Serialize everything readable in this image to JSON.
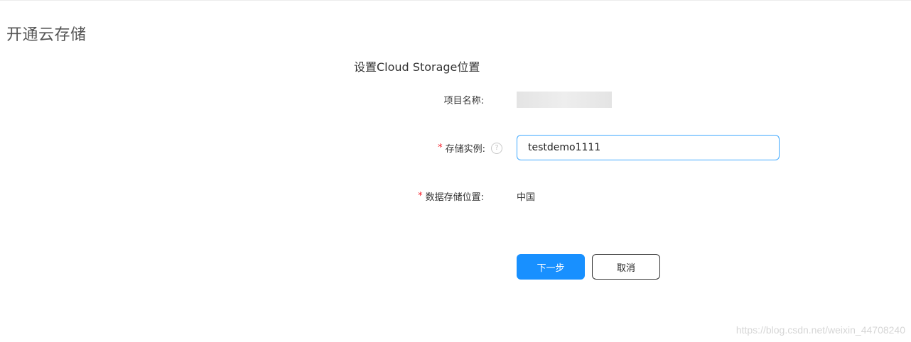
{
  "page": {
    "title": "开通云存储"
  },
  "form": {
    "section_title": "设置Cloud Storage位置",
    "project_name": {
      "label": "项目名称:"
    },
    "storage_instance": {
      "required_mark": "*",
      "label": "存储实例:",
      "help_icon": "?",
      "value": "testdemo1111"
    },
    "data_location": {
      "required_mark": "*",
      "label": "数据存储位置:",
      "value": "中国"
    }
  },
  "actions": {
    "next_label": "下一步",
    "cancel_label": "取消"
  },
  "watermark": {
    "text": "https://blog.csdn.net/weixin_44708240"
  },
  "colors": {
    "primary": "#1890ff",
    "required": "#f5222d",
    "input_focus_border": "#40a9ff"
  }
}
